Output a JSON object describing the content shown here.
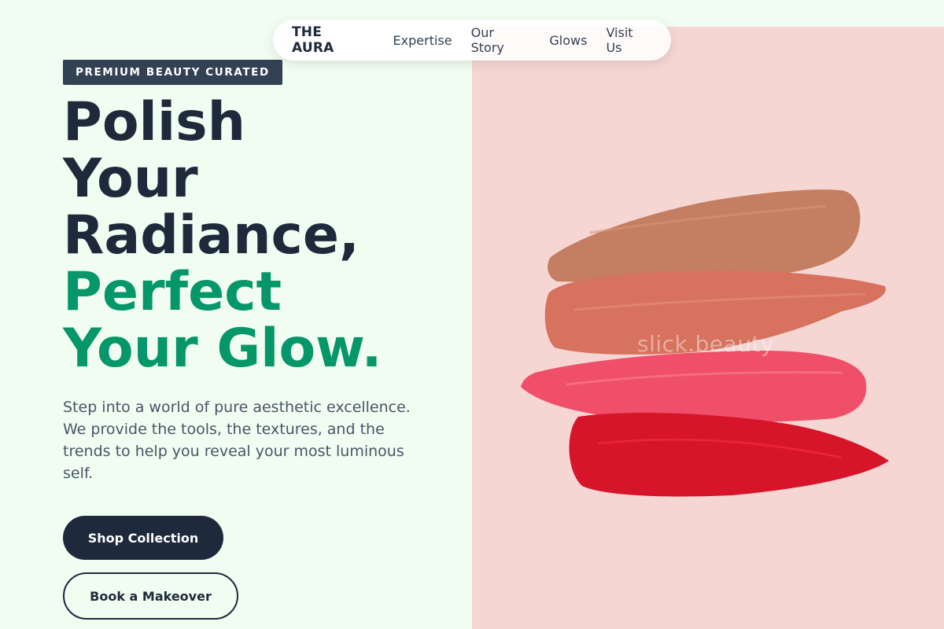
{
  "nav": {
    "brand": "THE AURA",
    "links": [
      "Expertise",
      "Our Story",
      "Glows",
      "Visit Us"
    ]
  },
  "hero": {
    "badge": "PREMIUM BEAUTY CURATED",
    "headline_lines": [
      "Polish",
      "Your",
      "Radiance,"
    ],
    "accent_lines": [
      "Perfect",
      "Your Glow."
    ],
    "description": "Step into a world of pure aesthetic excellence. We provide the tools, the textures, and the trends to help you reveal your most luminous self.",
    "primary_cta": "Shop Collection",
    "secondary_cta": "Book a Makeover"
  },
  "image": {
    "watermark": "slick.beauty",
    "swatch_colors": [
      "#c47e62",
      "#d6725e",
      "#ef4f68",
      "#d6142a"
    ]
  },
  "colors": {
    "background": "#f0fdf0",
    "dark": "#1e293b",
    "accent": "#059669",
    "image_background": "#f6d6d3"
  }
}
